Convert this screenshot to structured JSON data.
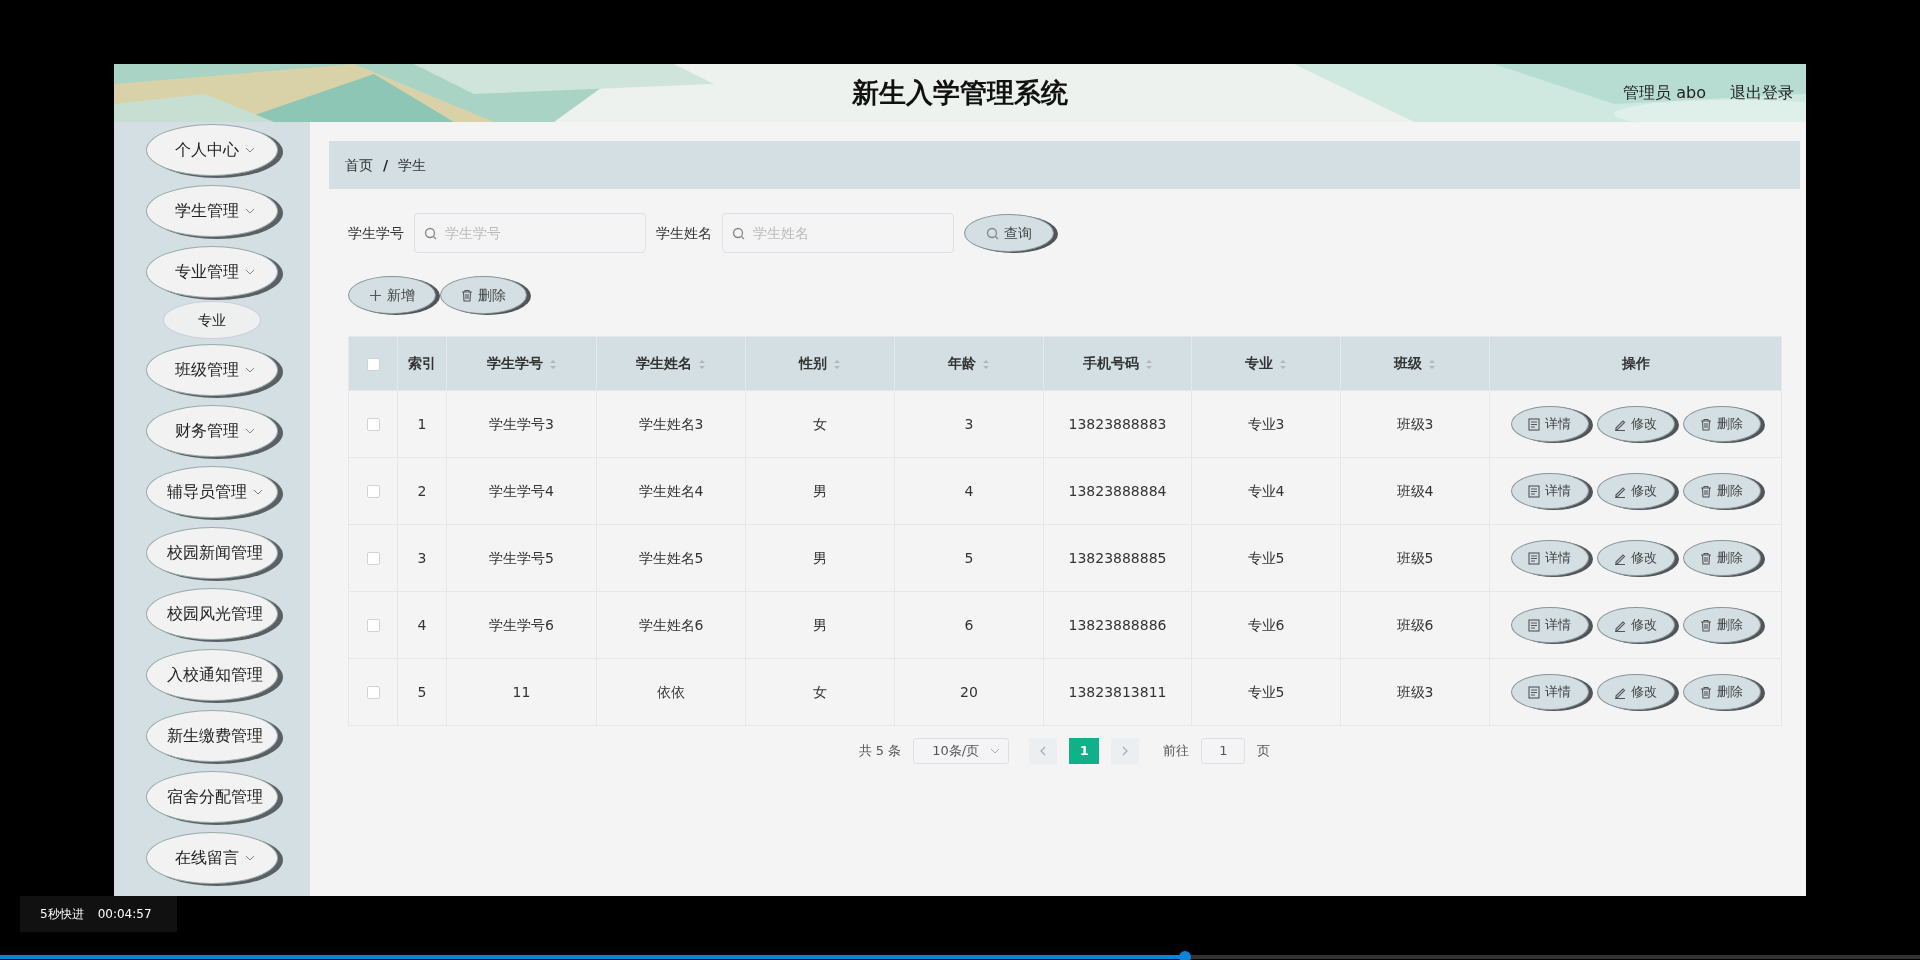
{
  "header": {
    "title": "新生入学管理系统",
    "user": "管理员 abo",
    "logout": "退出登录"
  },
  "sidebar": {
    "items": [
      {
        "label": "个人中心",
        "expandable": true
      },
      {
        "label": "学生管理",
        "expandable": true
      },
      {
        "label": "专业管理",
        "expandable": true,
        "children": [
          {
            "label": "专业"
          }
        ]
      },
      {
        "label": "班级管理",
        "expandable": true
      },
      {
        "label": "财务管理",
        "expandable": true
      },
      {
        "label": "辅导员管理",
        "expandable": true
      },
      {
        "label": "校园新闻管理",
        "expandable": false
      },
      {
        "label": "校园风光管理",
        "expandable": false
      },
      {
        "label": "入校通知管理",
        "expandable": false
      },
      {
        "label": "新生缴费管理",
        "expandable": false
      },
      {
        "label": "宿舍分配管理",
        "expandable": false
      },
      {
        "label": "在线留言",
        "expandable": true
      }
    ]
  },
  "breadcrumb": [
    {
      "label": "首页"
    },
    {
      "label": "学生"
    }
  ],
  "breadcrumb_separator": "/",
  "search": {
    "fields": [
      {
        "label": "学生学号",
        "placeholder": "学生学号"
      },
      {
        "label": "学生姓名",
        "placeholder": "学生姓名"
      }
    ],
    "button": "查询"
  },
  "toolbar": [
    {
      "kind": "add",
      "label": "新增"
    },
    {
      "kind": "delete",
      "label": "删除"
    }
  ],
  "table": {
    "select_all_checked": false,
    "columns": [
      {
        "label": "索引",
        "sortable": false
      },
      {
        "label": "学生学号",
        "sortable": true
      },
      {
        "label": "学生姓名",
        "sortable": true
      },
      {
        "label": "性别",
        "sortable": true
      },
      {
        "label": "年龄",
        "sortable": true
      },
      {
        "label": "手机号码",
        "sortable": true
      },
      {
        "label": "专业",
        "sortable": true
      },
      {
        "label": "班级",
        "sortable": true
      },
      {
        "label": "操作",
        "sortable": false
      }
    ],
    "rows": [
      {
        "checked": false,
        "cells": [
          "1",
          "学生学号3",
          "学生姓名3",
          "女",
          "3",
          "13823888883",
          "专业3",
          "班级3"
        ],
        "actions": [
          {
            "kind": "detail",
            "label": "详情"
          },
          {
            "kind": "edit",
            "label": "修改"
          },
          {
            "kind": "delete",
            "label": "删除"
          }
        ]
      },
      {
        "checked": false,
        "cells": [
          "2",
          "学生学号4",
          "学生姓名4",
          "男",
          "4",
          "13823888884",
          "专业4",
          "班级4"
        ],
        "actions": [
          {
            "kind": "detail",
            "label": "详情"
          },
          {
            "kind": "edit",
            "label": "修改"
          },
          {
            "kind": "delete",
            "label": "删除"
          }
        ]
      },
      {
        "checked": false,
        "cells": [
          "3",
          "学生学号5",
          "学生姓名5",
          "男",
          "5",
          "13823888885",
          "专业5",
          "班级5"
        ],
        "actions": [
          {
            "kind": "detail",
            "label": "详情"
          },
          {
            "kind": "edit",
            "label": "修改"
          },
          {
            "kind": "delete",
            "label": "删除"
          }
        ]
      },
      {
        "checked": false,
        "cells": [
          "4",
          "学生学号6",
          "学生姓名6",
          "男",
          "6",
          "13823888886",
          "专业6",
          "班级6"
        ],
        "actions": [
          {
            "kind": "detail",
            "label": "详情"
          },
          {
            "kind": "edit",
            "label": "修改"
          },
          {
            "kind": "delete",
            "label": "删除"
          }
        ]
      },
      {
        "checked": false,
        "cells": [
          "5",
          "11",
          "依依",
          "女",
          "20",
          "13823813811",
          "专业5",
          "班级3"
        ],
        "actions": [
          {
            "kind": "detail",
            "label": "详情"
          },
          {
            "kind": "edit",
            "label": "修改"
          },
          {
            "kind": "delete",
            "label": "删除"
          }
        ]
      }
    ]
  },
  "pagination": {
    "total": "共 5 条",
    "page_size": "10条/页",
    "pages": [
      {
        "label": "1",
        "selected": true
      }
    ],
    "goto_label": "前往",
    "goto_value": "1",
    "goto_suffix": "页"
  },
  "player": {
    "hint": "5秒快进",
    "time": "00:04:57",
    "progress": {
      "level": 0.617
    }
  }
}
